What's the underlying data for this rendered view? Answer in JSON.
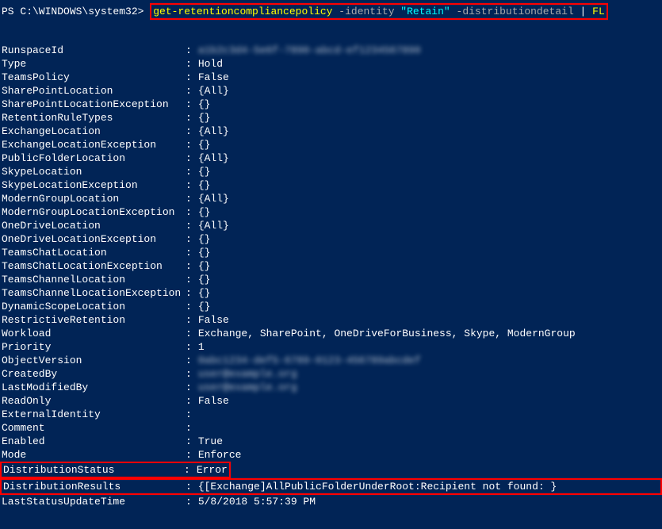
{
  "prompt": "PS C:\\WINDOWS\\system32> ",
  "command": {
    "cmd": "get-retentioncompliancepolicy",
    "param1": " -identity",
    "value1": " \"Retain\"",
    "param2": " -distributiondetail",
    "pipe": " | ",
    "fl": "  FL"
  },
  "rows": [
    {
      "key": "RunspaceId",
      "value": "a1b2c3d4-5e6f-7890-abcd-ef1234567890",
      "blurred": true
    },
    {
      "key": "Type",
      "value": "Hold"
    },
    {
      "key": "TeamsPolicy",
      "value": "False"
    },
    {
      "key": "SharePointLocation",
      "value": "{All}"
    },
    {
      "key": "SharePointLocationException",
      "value": "{}"
    },
    {
      "key": "RetentionRuleTypes",
      "value": "{}"
    },
    {
      "key": "ExchangeLocation",
      "value": "{All}"
    },
    {
      "key": "ExchangeLocationException",
      "value": "{}"
    },
    {
      "key": "PublicFolderLocation",
      "value": "{All}"
    },
    {
      "key": "SkypeLocation",
      "value": "{}"
    },
    {
      "key": "SkypeLocationException",
      "value": "{}"
    },
    {
      "key": "ModernGroupLocation",
      "value": "{All}"
    },
    {
      "key": "ModernGroupLocationException",
      "value": "{}"
    },
    {
      "key": "OneDriveLocation",
      "value": "{All}"
    },
    {
      "key": "OneDriveLocationException",
      "value": "{}"
    },
    {
      "key": "TeamsChatLocation",
      "value": "{}"
    },
    {
      "key": "TeamsChatLocationException",
      "value": "{}"
    },
    {
      "key": "TeamsChannelLocation",
      "value": "{}"
    },
    {
      "key": "TeamsChannelLocationException",
      "value": "{}"
    },
    {
      "key": "DynamicScopeLocation",
      "value": "{}"
    },
    {
      "key": "RestrictiveRetention",
      "value": "False"
    },
    {
      "key": "Workload",
      "value": "Exchange, SharePoint, OneDriveForBusiness, Skype, ModernGroup"
    },
    {
      "key": "Priority",
      "value": "1"
    },
    {
      "key": "ObjectVersion",
      "value": "0abc1234-def5-6789-0123-456789abcdef",
      "blurred": true
    },
    {
      "key": "CreatedBy",
      "value": "user@example.org",
      "blurred": true
    },
    {
      "key": "LastModifiedBy",
      "value": "user@example.org",
      "blurred": true
    },
    {
      "key": "ReadOnly",
      "value": "False"
    },
    {
      "key": "ExternalIdentity",
      "value": ""
    },
    {
      "key": "Comment",
      "value": ""
    },
    {
      "key": "Enabled",
      "value": "True"
    },
    {
      "key": "Mode",
      "value": "Enforce"
    },
    {
      "key": "DistributionStatus",
      "value": "Error",
      "redbox": "short"
    },
    {
      "key": "DistributionResults",
      "value": "{[Exchange]AllPublicFolderUnderRoot:Recipient not found: }",
      "redbox": "full"
    },
    {
      "key": "LastStatusUpdateTime",
      "value": "5/8/2018 5:57:39 PM"
    }
  ]
}
